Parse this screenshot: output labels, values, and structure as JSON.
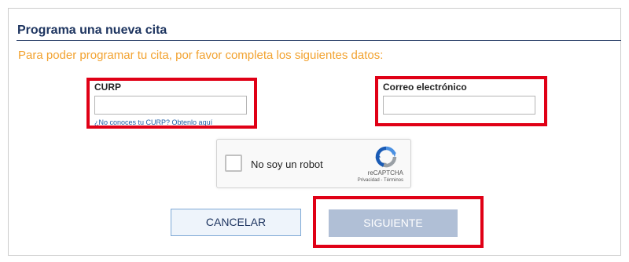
{
  "header": {
    "title": "Programa una nueva cita"
  },
  "form": {
    "instructions": "Para poder programar tu cita, por favor completa los siguientes datos:",
    "curp": {
      "label": "CURP",
      "value": "",
      "help_link": "¿No conoces tu CURP? Obtenlo aquí"
    },
    "email": {
      "label": "Correo electrónico",
      "value": ""
    }
  },
  "captcha": {
    "label": "No soy un robot",
    "brand": "reCAPTCHA",
    "terms": "Privacidad - Términos",
    "icon": "recaptcha-logo-icon"
  },
  "actions": {
    "cancel_label": "CANCELAR",
    "next_label": "SIGUIENTE"
  },
  "colors": {
    "title": "#1e3560",
    "instructions": "#f2a22f",
    "highlight_box": "#e00016",
    "next_button_disabled": "#b0bfd6",
    "link": "#1f5fa8"
  }
}
